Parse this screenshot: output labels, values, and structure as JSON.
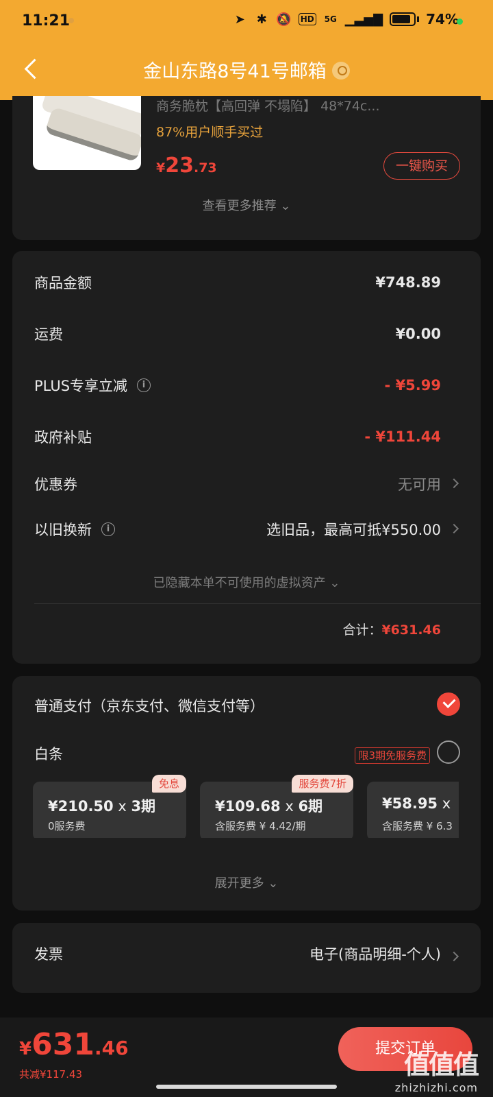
{
  "status_bar": {
    "time": "11:21",
    "network": "5G",
    "hd": "HD",
    "battery": "74%"
  },
  "header": {
    "title": "金山东路8号41号邮箱"
  },
  "recommendation": {
    "product_name": "商务脆枕【高回弹 不塌陷】  48*74c...",
    "bought_text": "87%用户顺手买过",
    "price_currency": "¥",
    "price_int": "23",
    "price_dec": ".73",
    "buy_label": "一键购买",
    "see_more": "查看更多推荐 ⌄"
  },
  "summary": {
    "rows": [
      {
        "label": "商品金额",
        "value": "¥748.89"
      },
      {
        "label": "运费",
        "value": "¥0.00"
      },
      {
        "label": "PLUS专享立减",
        "value": "- ¥5.99"
      },
      {
        "label": "政府补贴",
        "value": "- ¥111.44"
      },
      {
        "label": "优惠券",
        "value": "无可用"
      },
      {
        "label": "以旧换新",
        "value": "选旧品，最高可抵¥550.00"
      }
    ],
    "hidden_note": "已隐藏本单不可使用的虚拟资产 ⌄",
    "total_label": "合计：",
    "total_value": "¥631.46"
  },
  "payment": {
    "normal_label": "普通支付（京东支付、微信支付等）",
    "baitiao_label": "白条",
    "baitiao_promo": "限3期免服务费",
    "plans": [
      {
        "main": "¥210.50",
        "x": " x ",
        "term": "3期",
        "sub": "0服务费",
        "tag": "免息"
      },
      {
        "main": "¥109.68",
        "x": " x ",
        "term": "6期",
        "sub": "含服务费 ¥ 4.42/期",
        "tag": "服务费7折"
      },
      {
        "main": "¥58.95",
        "x": " x ",
        "term": "",
        "sub": "含服务费 ¥ 6.3",
        "tag": ""
      }
    ],
    "expand_more": "展开更多 ⌄"
  },
  "invoice": {
    "label": "发票",
    "value": "电子(商品明细-个人)"
  },
  "bottom": {
    "currency": "¥",
    "amount_int": "631",
    "amount_dec": ".46",
    "saved": "共减¥117.43",
    "submit_label": "提交订单"
  },
  "watermark": {
    "glyphs": "值值值",
    "url": "zhizhizhi.com"
  },
  "colors": {
    "header_bg": "#f3a930",
    "accent_red": "#f0463a",
    "card_bg": "#1e1e1e",
    "page_bg": "#0f0f0f"
  }
}
